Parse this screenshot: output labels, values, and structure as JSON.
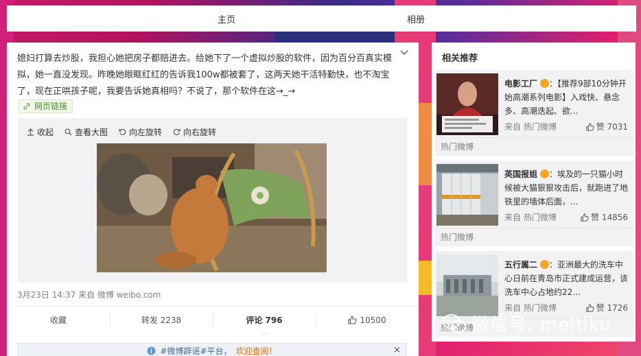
{
  "nav": {
    "home": "主页",
    "album": "相册"
  },
  "post": {
    "text": "媳妇打算去炒股，我担心她把房子都赔进去。给她下了一个虚拟炒股的软件，因为百分百真实模拟，她一直没发现。昨晚她眼眶红红的告诉我100w都被套了，这两天她干活特勤快，也不淘宝了，现在正哄孩子呢，我要告诉她真相吗？不说了，那个软件在这→_→",
    "web_link": "网页链接",
    "toolbar": {
      "collapse": "收起",
      "view_large": "查看大图",
      "rotate_left": "向左旋转",
      "rotate_right": "向右旋转"
    },
    "meta": "3月23日 14:37 来自 微博 weibo.com",
    "actions": {
      "favorite": "收藏",
      "repost": "转发 2238",
      "comment": "评论 796",
      "like": "10500"
    },
    "notice": {
      "prefix": "#微博辟谣#平台，",
      "highlight": "欢迎查阅！",
      "close": "×"
    }
  },
  "sidebar": {
    "title": "相关推荐",
    "items": [
      {
        "name": "电影工厂",
        "desc": "：【推荐9部10分钟开始高潮系列电影】入戏快、悬念多、高潮迭起、欲...",
        "from": "来自 热门微博",
        "likes": "赞 7031",
        "footer": "热门微博"
      },
      {
        "name": "英国报姐",
        "desc": "：埃及的一只猫小时候被大猫狠狠攻击后，就跑进了地铁里的墙体后面，...",
        "from": "来自 热门微博",
        "likes": "赞 14856",
        "footer": "热门微博"
      },
      {
        "name": "五行属二",
        "desc": "：亚洲最大的洗车中心日前在青岛市正式建成运营，该洗车中心占地约22...",
        "from": "来自 热门微博",
        "likes": "赞 1726",
        "footer": "热门微博"
      }
    ]
  },
  "watermark": "微信号: meitiku",
  "colors": {
    "accent_orange": "#e06a00",
    "link_green": "#4b8b24",
    "panel_gray": "#f2f2f5"
  }
}
